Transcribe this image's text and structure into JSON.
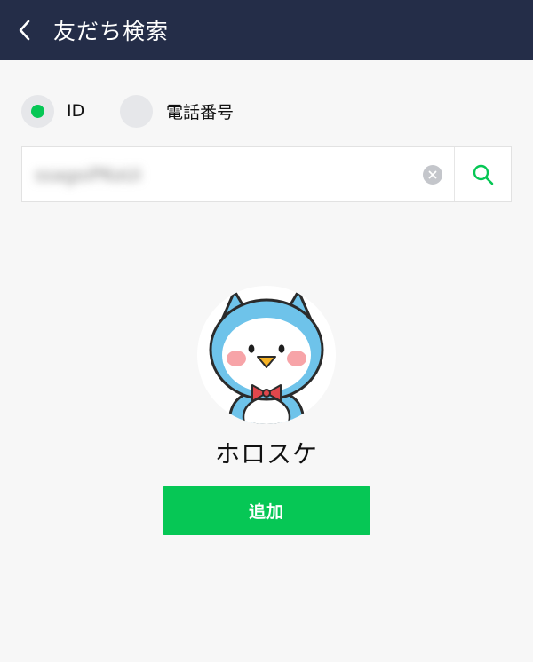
{
  "header": {
    "title": "友だち検索",
    "back_icon": "chevron-left-icon",
    "background": "#242d48"
  },
  "search_type": {
    "options": [
      {
        "label": "ID",
        "selected": true
      },
      {
        "label": "電話番号",
        "selected": false
      }
    ],
    "accent": "#06c755"
  },
  "search": {
    "value": "ssagoiPKoUi",
    "clear_icon": "clear-icon",
    "search_icon": "search-icon"
  },
  "result": {
    "name": "ホロスケ",
    "add_label": "追加",
    "add_color": "#06c755"
  }
}
